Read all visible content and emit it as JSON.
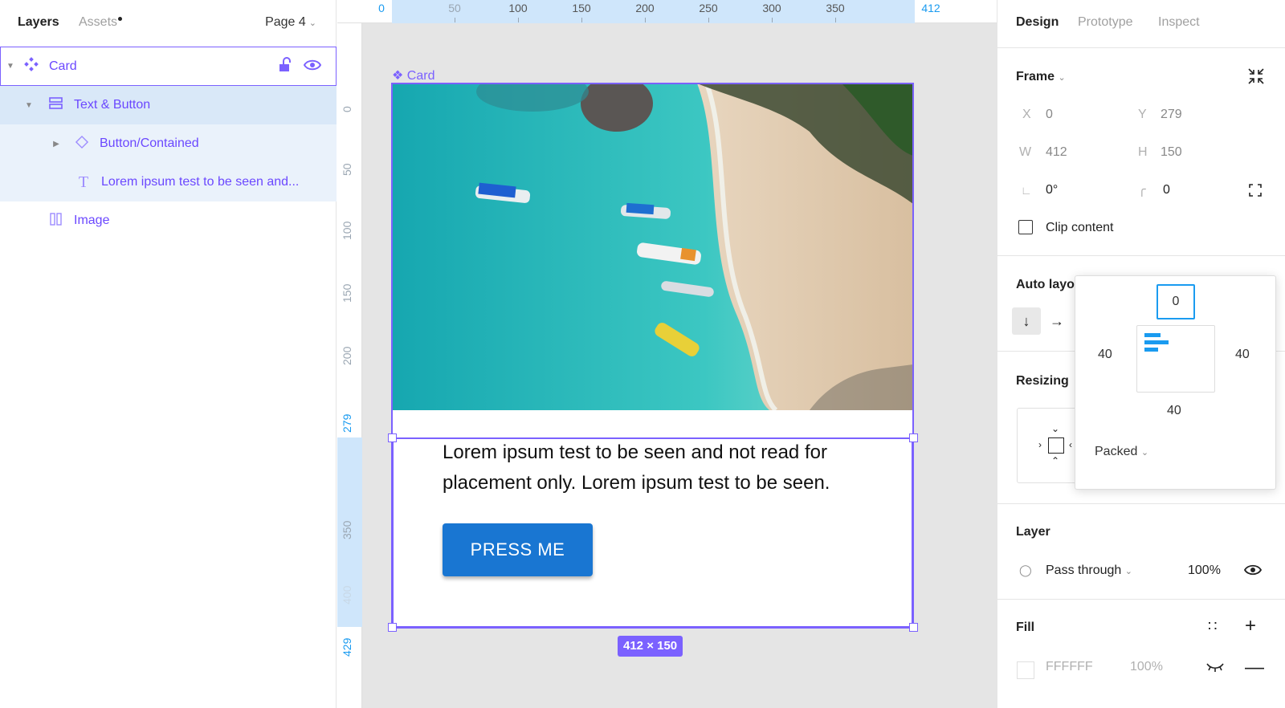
{
  "layers_panel": {
    "tab_layers": "Layers",
    "tab_assets": "Assets",
    "page": "Page 4",
    "rows": [
      {
        "label": "Card"
      },
      {
        "label": "Text & Button"
      },
      {
        "label": "Button/Contained"
      },
      {
        "label": "Lorem ipsum test to be seen and..."
      },
      {
        "label": "Image"
      }
    ]
  },
  "canvas": {
    "ruler_top": [
      "0",
      "50",
      "100",
      "150",
      "200",
      "250",
      "300",
      "350",
      "412"
    ],
    "ruler_left": [
      "0",
      "50",
      "100",
      "150",
      "200",
      "279",
      "350",
      "400",
      "429"
    ],
    "frame_label": "Card",
    "card_text": "Lorem ipsum test to be seen and not read for placement only. Lorem ipsum test to be seen.",
    "button_label": "PRESS ME",
    "size_badge": "412 × 150"
  },
  "design_panel": {
    "tabs": [
      "Design",
      "Prototype",
      "Inspect"
    ],
    "frame_title": "Frame",
    "x_label": "X",
    "x": "0",
    "y_label": "Y",
    "y": "279",
    "w_label": "W",
    "w": "412",
    "h_label": "H",
    "h": "150",
    "rotation": "0°",
    "radius": "0",
    "clip_content": "Clip content",
    "auto_layout_title": "Auto layo",
    "resizing_title": "Resizing",
    "layer_title": "Layer",
    "blend_mode": "Pass through",
    "layer_opacity": "100%",
    "fill_title": "Fill",
    "fill_hex": "FFFFFF",
    "fill_opacity": "100%"
  },
  "padding_popup": {
    "top": "0",
    "left": "40",
    "right": "40",
    "bottom": "40",
    "distribution": "Packed"
  },
  "colors": {
    "accent": "#7b61ff",
    "selection": "#1a9bf0",
    "button": "#1976d2"
  }
}
